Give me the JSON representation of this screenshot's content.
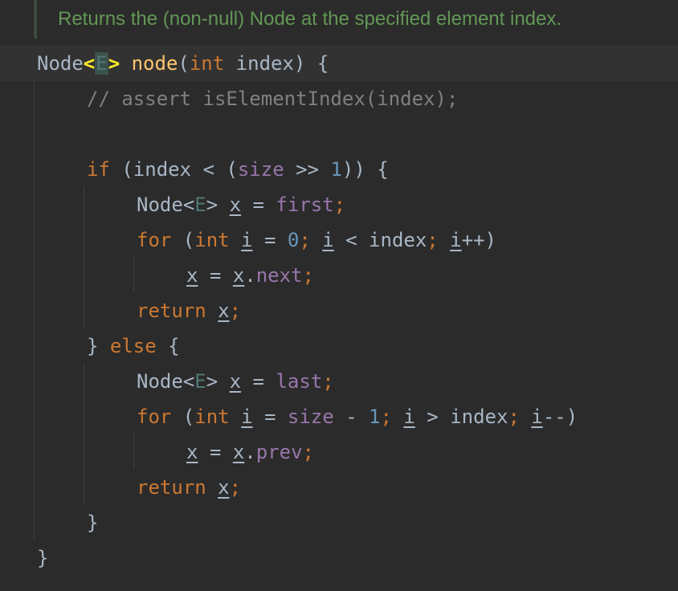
{
  "doc_comment": "Returns the (non-null) Node at the specified element index.",
  "code": {
    "l1": {
      "type": "Node",
      "lt": "<",
      "tparam": "E",
      "gt": ">",
      "sp": " ",
      "name": "node",
      "open": "(",
      "int": "int",
      "param": " index) {"
    },
    "l2": {
      "comment": "// assert isElementIndex(index);"
    },
    "l4": {
      "if": "if",
      "a": " (index < (",
      "size": "size",
      "b": " >> ",
      "one": "1",
      "c": ")) {"
    },
    "l5": {
      "a": "Node<",
      "e": "E",
      "b": "> ",
      "x": "x",
      "c": " = ",
      "first": "first",
      "semi": ";"
    },
    "l6": {
      "for": "for",
      "a": " (",
      "int": "int",
      "sp": " ",
      "i1": "i",
      "b": " = ",
      "zero": "0",
      "semi1": ";",
      "sp2": " ",
      "i2": "i",
      "c": " < index",
      "semi2": ";",
      "sp3": " ",
      "i3": "i",
      "d": "++)"
    },
    "l7": {
      "x1": "x",
      "a": " = ",
      "x2": "x",
      "dot": ".",
      "next": "next",
      "semi": ";"
    },
    "l8": {
      "ret": "return",
      "sp": " ",
      "x": "x",
      "semi": ";"
    },
    "l9": {
      "a": "} ",
      "else": "else",
      "b": " {"
    },
    "l10": {
      "a": "Node<",
      "e": "E",
      "b": "> ",
      "x": "x",
      "c": " = ",
      "last": "last",
      "semi": ";"
    },
    "l11": {
      "for": "for",
      "a": " (",
      "int": "int",
      "sp": " ",
      "i1": "i",
      "b": " = ",
      "size": "size",
      "c": " - ",
      "one": "1",
      "semi1": ";",
      "sp2": " ",
      "i2": "i",
      "d": " > index",
      "semi2": ";",
      "sp3": " ",
      "i3": "i",
      "e": "--)"
    },
    "l12": {
      "x1": "x",
      "a": " = ",
      "x2": "x",
      "dot": ".",
      "prev": "prev",
      "semi": ";"
    },
    "l13": {
      "ret": "return",
      "sp": " ",
      "x": "x",
      "semi": ";"
    },
    "l14": {
      "brace": "}"
    },
    "l15": {
      "brace": "}"
    }
  },
  "colors": {
    "background": "#2b2b2b",
    "keyword": "#cc7832",
    "method": "#ffc66d",
    "field": "#9876aa",
    "number": "#6897bb",
    "comment": "#808080",
    "doc_comment": "#629755",
    "type_param": "#507874",
    "brace_match": "#ffef28"
  }
}
